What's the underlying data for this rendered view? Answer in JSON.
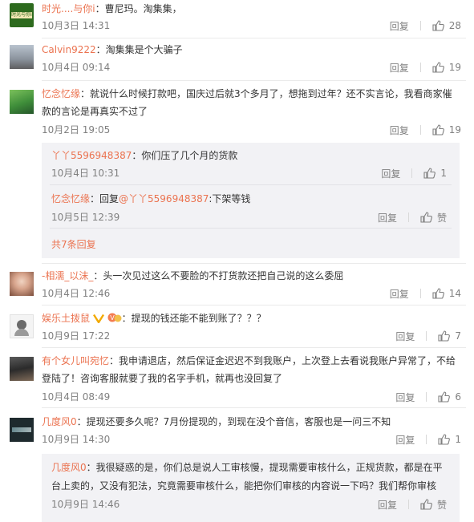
{
  "colors": {
    "link": "#eb7350",
    "meta": "#808080",
    "subbg": "#f2f2f5"
  },
  "labels": {
    "reply": "回复",
    "like_zero": "赞"
  },
  "comments": [
    {
      "user": "时光....与你i",
      "text": "：曹尼玛。淘集集，",
      "date": "10月3日 14:31",
      "likes": "28"
    },
    {
      "user": "Calvin9222",
      "text": "：淘集集是个大骗子",
      "date": "10月4日 09:14",
      "likes": "19"
    },
    {
      "user": "忆念忆缘",
      "text_l1": "：就说什么时候打款吧，国庆过后就3个多月了，想拖到过年？还不实言论，我看商家催",
      "text_l2": "款的言论是再真实不过了",
      "date": "10月2日 19:05",
      "likes": "19",
      "subs": [
        {
          "user": "丫丫5596948387",
          "text": "：你们压了几个月的货款",
          "date": "10月4日 10:31",
          "likes": "1"
        },
        {
          "user": "忆念忆缘",
          "text_pre": "：回复",
          "at": "@丫丫5596948387",
          "text_post": ":下架等钱",
          "date": "10月5日 12:39"
        }
      ],
      "more": "共7条回复"
    },
    {
      "user": "-相濡_以沫_",
      "text": "：头一次见过这么不要脸的不打货款还把自己说的这么委屈",
      "date": "10月4日 12:46",
      "likes": "14"
    },
    {
      "user": "娱乐土拨鼠",
      "text": "：提现的钱还能不能到账了？？？",
      "date": "10月9日 17:22",
      "likes": "7"
    },
    {
      "user": "有个女儿叫宛忆",
      "text_l1": "：我申请退店，然后保证金迟迟不到我账户，上次登上去看说我账户异常了，不给",
      "text_l2": "登陆了！咨询客服就要了我的名字手机，就再也没回复了",
      "date": "10月4日 08:49",
      "likes": "6"
    },
    {
      "user": "几度风0",
      "text": "：提现还要多久呢？7月份提现的，到现在没个音信，客服也是一问三不知",
      "date": "10月9日 14:30",
      "likes": "1",
      "subs": [
        {
          "user": "几度风0",
          "text_l1": "：我很疑惑的是，你们总是说人工审核慢，提现需要审核什么，正规货款，都是在平",
          "text_l2": "台上卖的，又没有犯法，究竟需要审核什么，能把你们审核的内容说一下吗？我们帮你审核",
          "date": "10月9日 14:46"
        }
      ]
    }
  ],
  "avatars": {
    "a1_text": "时光与你i"
  }
}
